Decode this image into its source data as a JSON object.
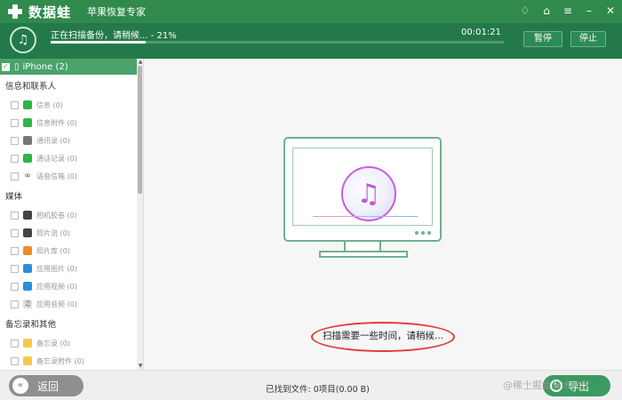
{
  "titlebar": {
    "brand": "数据蛙",
    "app_title": "苹果恢复专家",
    "controls": [
      "diamond-icon",
      "shirt-icon",
      "menu-icon",
      "minimize-icon",
      "close-icon"
    ]
  },
  "scan": {
    "status_text": "正在扫描备份，请稍候... - 21%",
    "progress": 0.21,
    "elapsed": "00:01:21",
    "pause_label": "暂停",
    "stop_label": "停止"
  },
  "sidebar": {
    "device": "iPhone (2)",
    "groups": [
      {
        "title": "信息和联系人",
        "items": [
          {
            "label": "信息 (0)",
            "icon": "message-icon"
          },
          {
            "label": "信息附件 (0)",
            "icon": "message-attachment-icon"
          },
          {
            "label": "通讯录 (0)",
            "icon": "contacts-icon"
          },
          {
            "label": "通话记录 (0)",
            "icon": "phone-icon"
          },
          {
            "label": "语音信箱 (0)",
            "icon": "voicemail-icon"
          }
        ]
      },
      {
        "title": "媒体",
        "items": [
          {
            "label": "相机胶卷 (0)",
            "icon": "camera-icon"
          },
          {
            "label": "照片流 (0)",
            "icon": "photo-stream-icon"
          },
          {
            "label": "照片库 (0)",
            "icon": "photos-icon"
          },
          {
            "label": "应用图片 (0)",
            "icon": "app-photo-icon"
          },
          {
            "label": "应用视频 (0)",
            "icon": "app-video-icon"
          },
          {
            "label": "应用音频 (0)",
            "icon": "app-audio-icon"
          }
        ]
      },
      {
        "title": "备忘录和其他",
        "items": [
          {
            "label": "备忘录 (0)",
            "icon": "notes-icon"
          },
          {
            "label": "备忘录附件 (0)",
            "icon": "notes-attachment-icon"
          }
        ]
      }
    ]
  },
  "main": {
    "wait_text": "扫描需要一些时间，请稍候..."
  },
  "footer": {
    "back_label": "返回",
    "found_text": "已找到文件: 0项目(0.00 B)",
    "export_label": "导出"
  },
  "watermark": "@稀土掘金技术社区",
  "colors": {
    "titlebar": "#2f8a4c",
    "progress_bg": "#23794a",
    "accent": "#3b9a5f",
    "highlight_ellipse": "#e23a3a"
  }
}
